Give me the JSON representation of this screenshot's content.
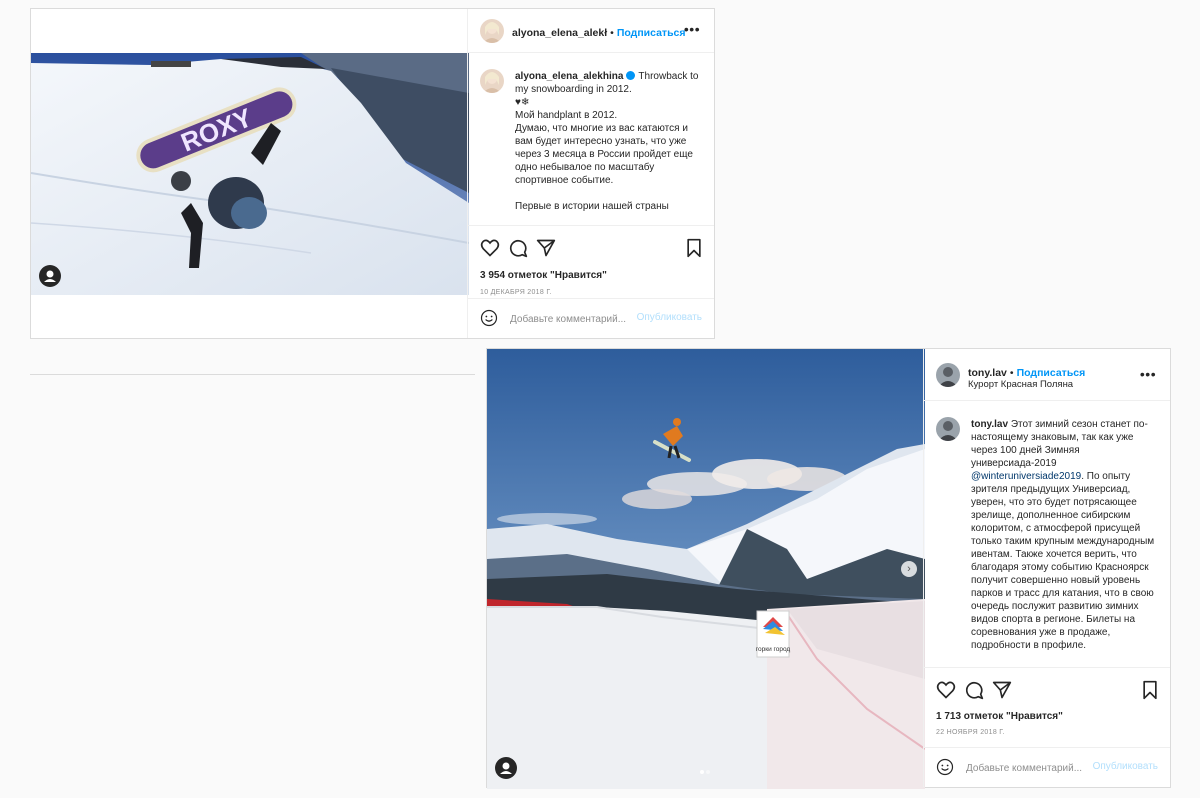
{
  "post1": {
    "username": "alyona_elena_alekhina",
    "username_short": "alyona_elena_alekł",
    "follow_label": "Подписаться",
    "more_label": "•••",
    "caption": "Throwback to my snowboarding in 2012.\n♥❄\nМой handplant в 2012.\nДумаю, что многие из вас катаются и вам будет интересно узнать, что уже через 3 месяца в России пройдет еще одно небывалое по масштабу спортивное событие.\n\nПервые в истории нашей страны",
    "likes": "3 954 отметок \"Нравится\"",
    "date": "10 декабря 2018 г.",
    "comment_placeholder": "Добавьте комментарий...",
    "publish_label": "Опубликовать",
    "board_brand": "ROXY"
  },
  "post2": {
    "username": "tony.lav",
    "follow_label": "Подписаться",
    "location": "Курорт Красная Поляна",
    "more_label": "•••",
    "caption_part1": "Этот зимний сезон станет по-настоящему знаковым, так как уже через 100 дней Зимняя универсиада-2019 ",
    "mention": "@winteruniversiade2019",
    "caption_part2": ". По опыту зрителя предыдущих Универсиад, уверен, что это будет потрясающее зрелище, дополненное сибирским колоритом, с атмосферой присущей только таким крупным международным ивентам. Также хочется верить, что благодаря этому событию Красноярск получит совершенно новый уровень парков и трасс для катания, что в свою очередь послужит развитию зимних видов спорта в регионе. Билеты на соревнования уже в продаже, подробности в профиле.",
    "likes": "1 713 отметок \"Нравится\"",
    "date": "22 ноября 2018 г.",
    "comment_placeholder": "Добавьте комментарий...",
    "publish_label": "Опубликовать",
    "sign_text": "горки город"
  },
  "colors": {
    "accent": "#0095f6",
    "border": "#dbdbdb",
    "muted": "#8e8e8e",
    "publish_disabled": "#b2dffc"
  }
}
